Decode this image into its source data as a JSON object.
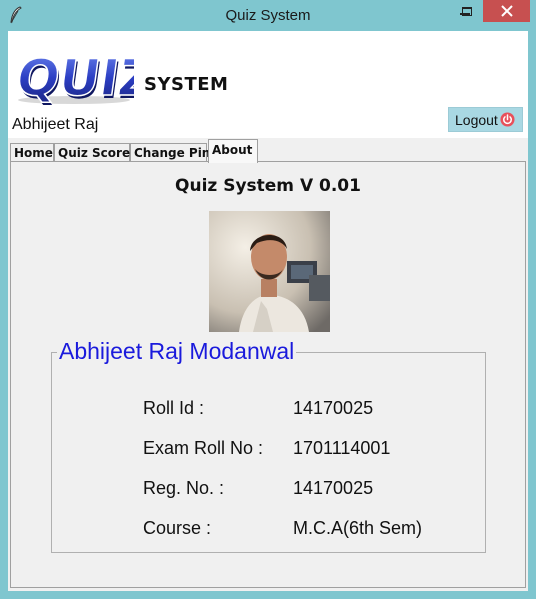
{
  "window": {
    "title": "Quiz System"
  },
  "header": {
    "logo_text": "QUIZ!",
    "system_text": "SYSTEM",
    "user_name": "Abhijeet Raj",
    "logout_label": "Logout"
  },
  "tabs": [
    {
      "label": "Home"
    },
    {
      "label": "Quiz Score"
    },
    {
      "label": "Change Pin"
    },
    {
      "label": "About"
    }
  ],
  "about": {
    "title": "Quiz System V 0.01",
    "full_name": "Abhijeet Raj Modanwal",
    "rows": [
      {
        "label": "Roll Id :",
        "value": "14170025"
      },
      {
        "label": "Exam Roll No :",
        "value": "1701114001"
      },
      {
        "label": "Reg. No. :",
        "value": "14170025"
      },
      {
        "label": "Course :",
        "value": "M.C.A(6th Sem)"
      }
    ]
  },
  "colors": {
    "frame": "#7fc6cf",
    "close": "#c75050",
    "logout_bg": "#a9d8e3",
    "name_blue": "#1a1adc",
    "logo_blue": "#2c3fc4"
  }
}
